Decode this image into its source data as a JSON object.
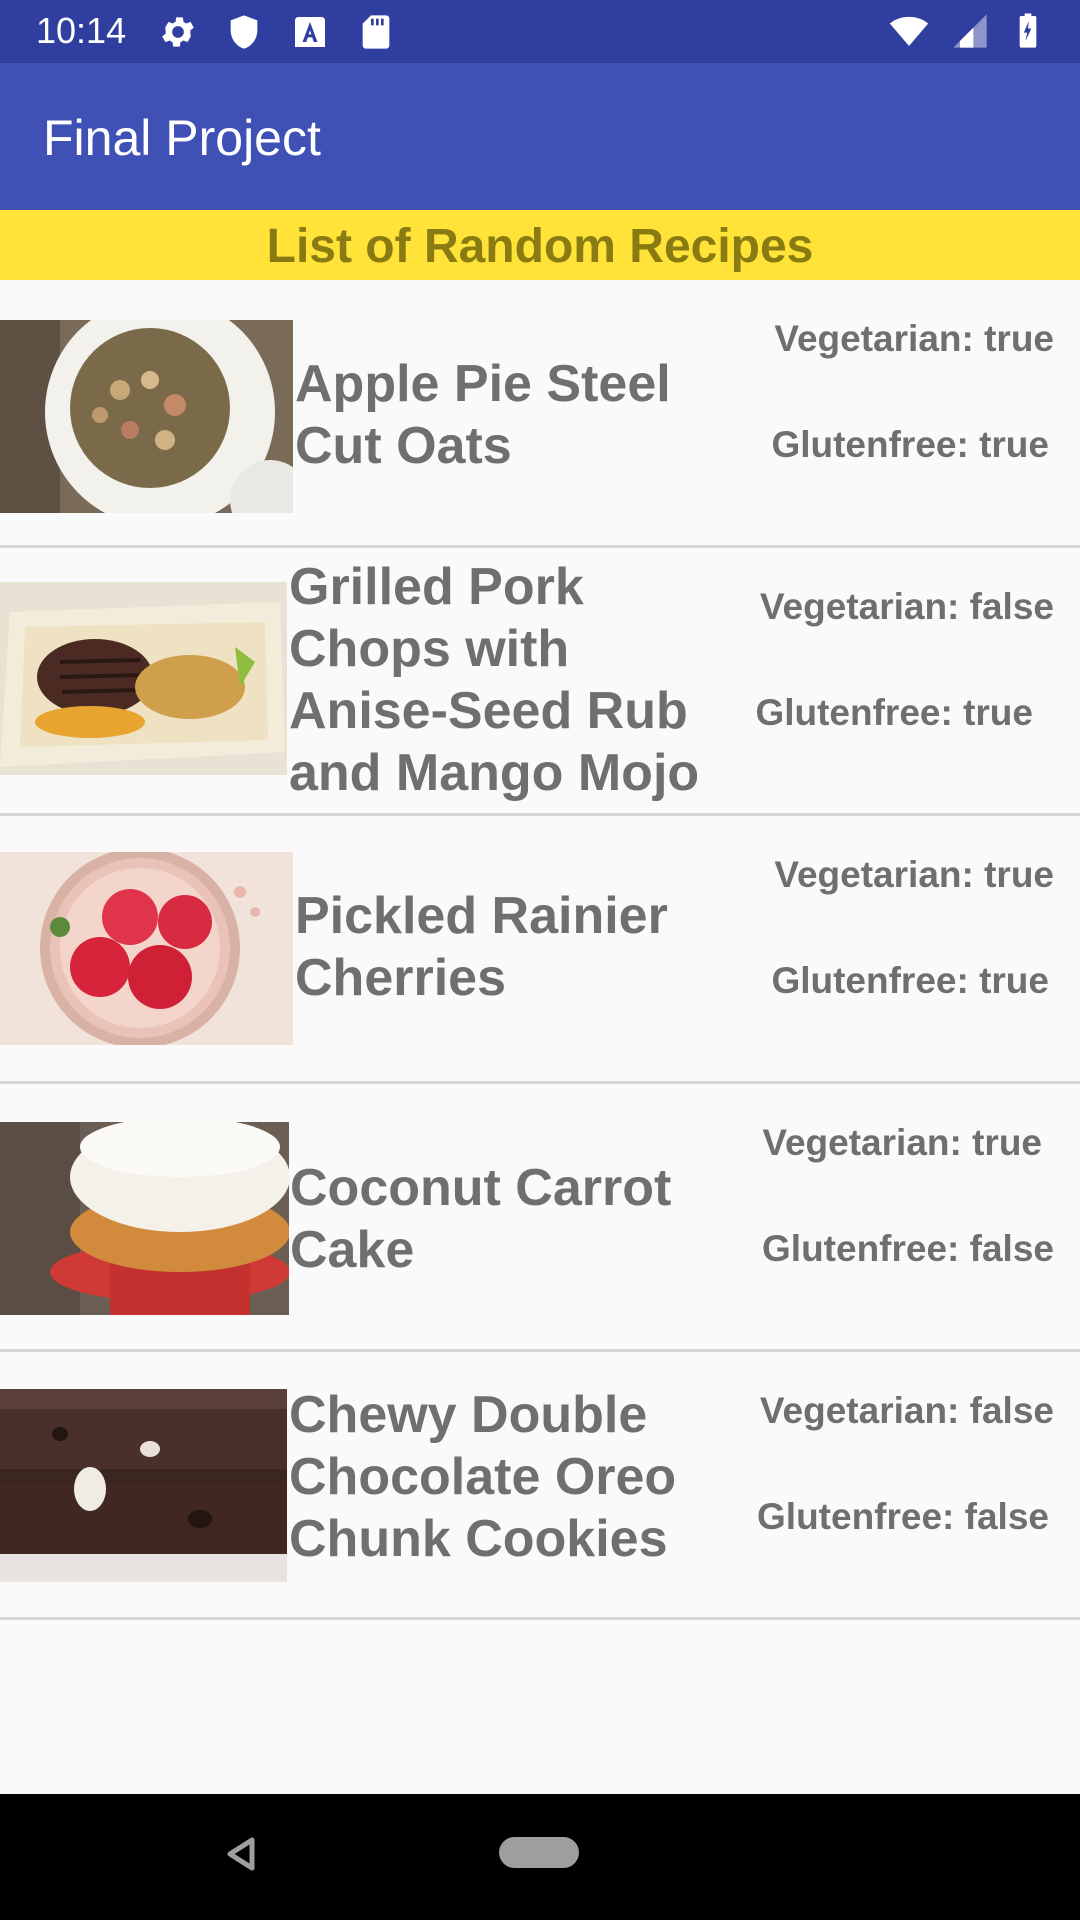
{
  "status_bar": {
    "time": "10:14",
    "left_icons": [
      "gear-icon",
      "shield-icon",
      "a-icon",
      "sd-card-icon"
    ],
    "right_icons": [
      "wifi-icon",
      "signal-icon",
      "battery-icon"
    ]
  },
  "app_bar": {
    "title": "Final Project",
    "color": "#3f51b5"
  },
  "banner": {
    "text": "List of Random Recipes",
    "color": "#ffe338"
  },
  "recipes": [
    {
      "title": "Apple Pie Steel Cut Oats",
      "vegetarian": "Vegetarian: true",
      "glutenfree": "Glutenfree: true"
    },
    {
      "title": "Grilled Pork Chops with Anise-Seed Rub and Mango Mojo",
      "vegetarian": "Vegetarian: false",
      "glutenfree": "Glutenfree: true"
    },
    {
      "title": "Pickled Rainier Cherries",
      "vegetarian": "Vegetarian: true",
      "glutenfree": "Glutenfree: true"
    },
    {
      "title": "Coconut Carrot Cake",
      "vegetarian": "Vegetarian: true",
      "glutenfree": "Glutenfree: false"
    },
    {
      "title": "Chewy Double Chocolate Oreo Chunk Cookies",
      "vegetarian": "Vegetarian: false",
      "glutenfree": "Glutenfree: false"
    }
  ],
  "nav_bar": {
    "icons": [
      "back-icon",
      "home-icon"
    ]
  }
}
